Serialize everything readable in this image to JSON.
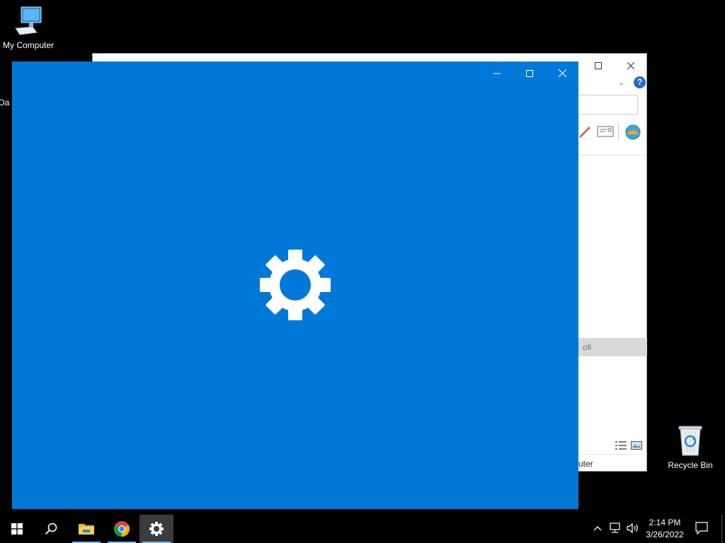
{
  "desktop": {
    "icons": [
      {
        "name": "my-computer",
        "label": "My Computer"
      },
      {
        "name": "recycle-bin",
        "label": "Recycle Bin"
      },
      {
        "name": "partial-icon",
        "label": "Da"
      }
    ]
  },
  "background_window": {
    "help_label": "?",
    "gray_strip_text": "oll",
    "status_text": "uter"
  },
  "settings_window": {
    "buttons": {
      "minimize": "minimize",
      "maximize": "maximize",
      "close": "close"
    },
    "splash_icon": "gear-icon",
    "accent_color": "#0078d7"
  },
  "taskbar": {
    "items": [
      "start",
      "search",
      "file-explorer",
      "chrome",
      "settings"
    ],
    "active_item": "settings",
    "clock": {
      "time": "2:14 PM",
      "date": "3/26/2022"
    }
  }
}
